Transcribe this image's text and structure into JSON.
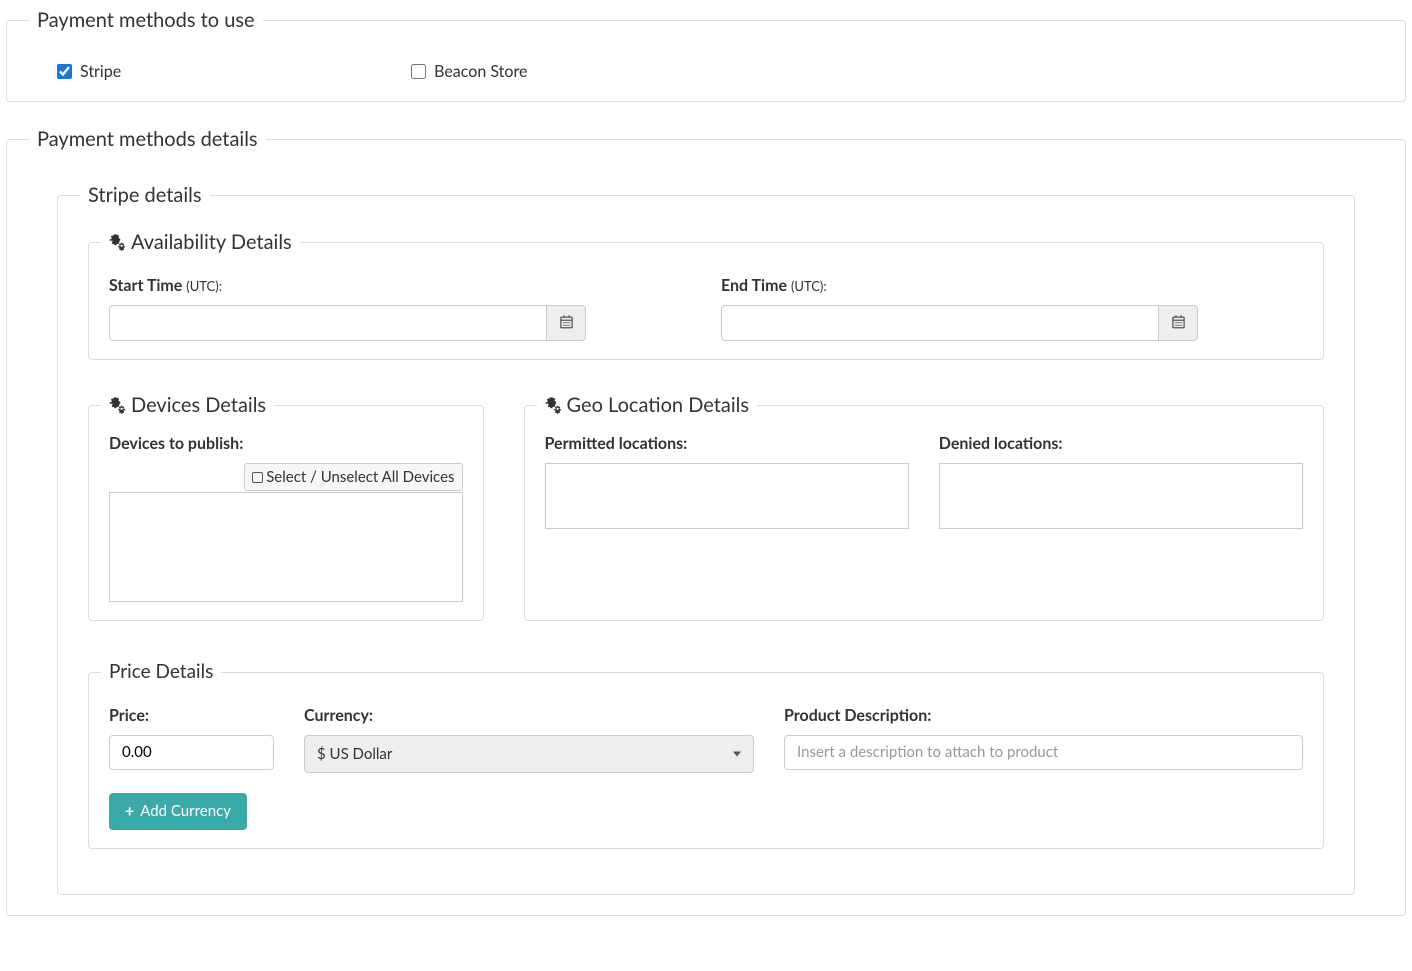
{
  "payment_methods_to_use": {
    "legend": "Payment methods to use",
    "options": {
      "stripe": {
        "label": "Stripe",
        "checked": true
      },
      "beacon": {
        "label": "Beacon Store",
        "checked": false
      }
    }
  },
  "payment_methods_details": {
    "legend": "Payment methods details",
    "stripe": {
      "legend": "Stripe details",
      "availability": {
        "legend": "Availability Details",
        "start_label": "Start Time ",
        "start_utc": "(UTC):",
        "start_value": "",
        "end_label": "End Time ",
        "end_utc": "(UTC):",
        "end_value": ""
      },
      "devices": {
        "legend": "Devices Details",
        "label": "Devices to publish:",
        "select_all": "Select / Unselect All Devices"
      },
      "geo": {
        "legend": "Geo Location Details",
        "permitted_label": "Permitted locations:",
        "denied_label": "Denied locations:"
      },
      "price": {
        "legend": "Price Details",
        "price_label": "Price:",
        "price_value": "0.00",
        "currency_label": "Currency:",
        "currency_value": "$ US Dollar",
        "desc_label": "Product Description:",
        "desc_placeholder": "Insert a description to attach to product",
        "add_currency": "Add Currency"
      }
    }
  }
}
